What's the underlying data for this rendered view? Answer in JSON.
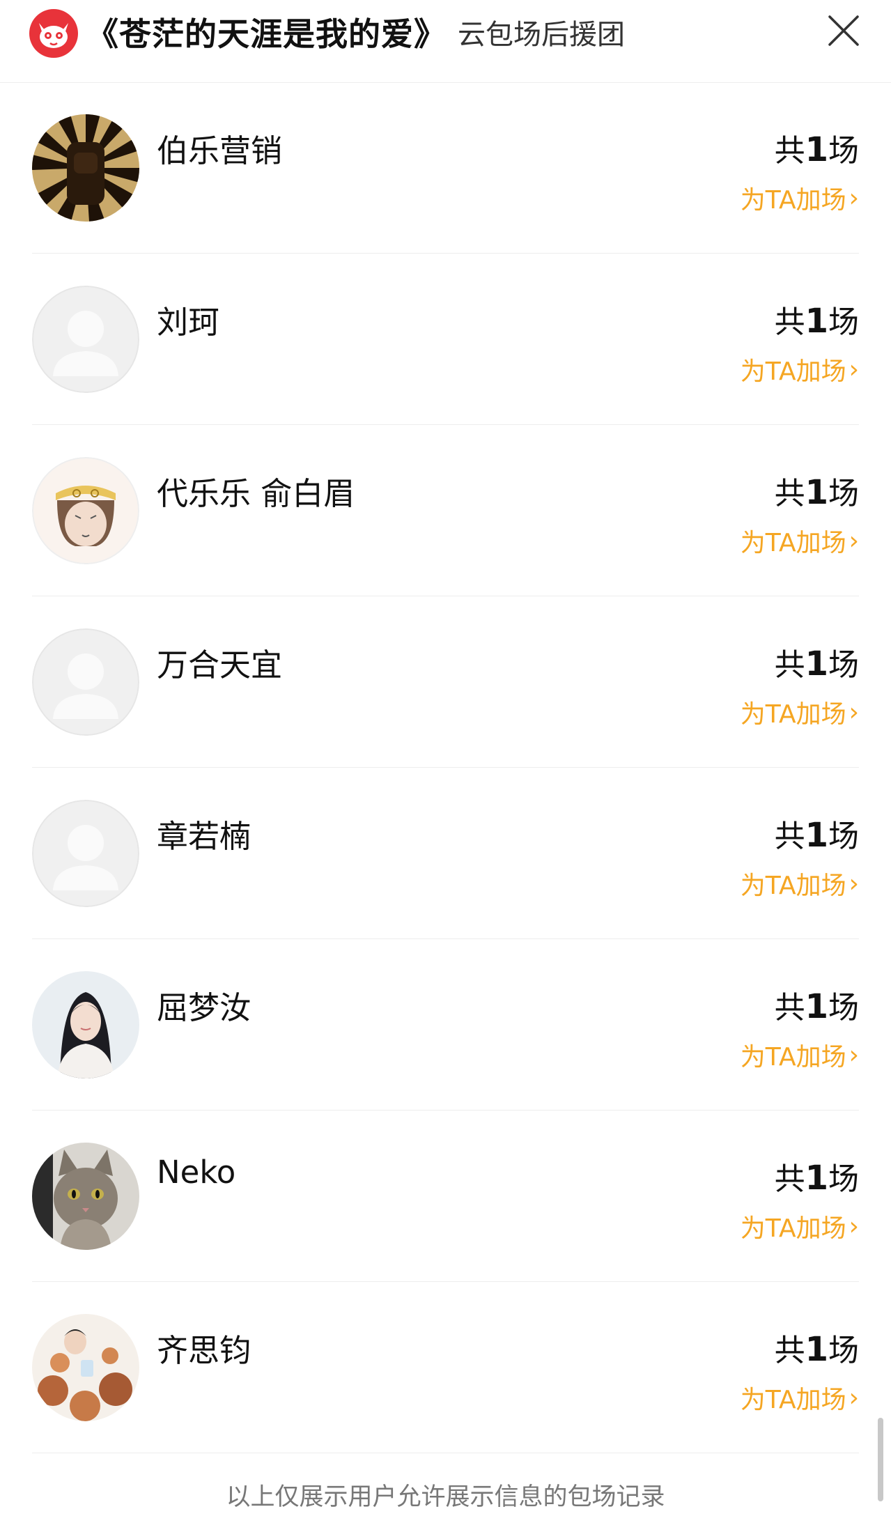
{
  "header": {
    "title": "《苍茫的天涯是我的爱》",
    "subtitle": "云包场后援团",
    "logo_icon": "cat-logo-icon",
    "close_icon": "close-icon",
    "brand_color": "#e8333a"
  },
  "supporters": [
    {
      "name": "伯乐营销",
      "count_prefix": "共",
      "count": "1",
      "count_suffix": "场",
      "action": "为TA加场",
      "avatar": "sunburst-avatar"
    },
    {
      "name": "刘珂",
      "count_prefix": "共",
      "count": "1",
      "count_suffix": "场",
      "action": "为TA加场",
      "avatar": "default-avatar"
    },
    {
      "name": "代乐乐 俞白眉",
      "count_prefix": "共",
      "count": "1",
      "count_suffix": "场",
      "action": "为TA加场",
      "avatar": "monkey-king-avatar"
    },
    {
      "name": "万合天宜",
      "count_prefix": "共",
      "count": "1",
      "count_suffix": "场",
      "action": "为TA加场",
      "avatar": "default-avatar"
    },
    {
      "name": "章若楠",
      "count_prefix": "共",
      "count": "1",
      "count_suffix": "场",
      "action": "为TA加场",
      "avatar": "default-avatar"
    },
    {
      "name": "屈梦汝",
      "count_prefix": "共",
      "count": "1",
      "count_suffix": "场",
      "action": "为TA加场",
      "avatar": "woman-portrait-avatar"
    },
    {
      "name": "Neko",
      "count_prefix": "共",
      "count": "1",
      "count_suffix": "场",
      "action": "为TA加场",
      "avatar": "cat-photo-avatar"
    },
    {
      "name": "齐思钧",
      "count_prefix": "共",
      "count": "1",
      "count_suffix": "场",
      "action": "为TA加场",
      "avatar": "man-with-toys-avatar"
    }
  ],
  "footer": {
    "note": "以上仅展示用户允许展示信息的包场记录"
  },
  "colors": {
    "accent": "#f5a623",
    "divider": "#ededed"
  }
}
